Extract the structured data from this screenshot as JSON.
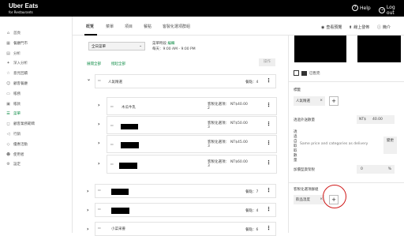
{
  "app": {
    "logo_line1": "Uber Eats",
    "logo_line2": "for Restaurants",
    "help": "Help",
    "logout": "Log out"
  },
  "sidebar": {
    "items": [
      {
        "label": "首頁",
        "icon": "home-icon"
      },
      {
        "label": "餐廳門市",
        "icon": "store-icon"
      },
      {
        "label": "分析",
        "icon": "chart-icon"
      },
      {
        "label": "深入分析",
        "icon": "sparkle-icon"
      },
      {
        "label": "意見回饋",
        "icon": "star-icon"
      },
      {
        "label": "顧客餐廳",
        "icon": "people-icon"
      },
      {
        "label": "帳務",
        "icon": "receipt-icon"
      },
      {
        "label": "帳款",
        "icon": "wallet-icon"
      },
      {
        "label": "菜單",
        "icon": "menu-icon"
      },
      {
        "label": "顧客業務範疇",
        "icon": "box-icon"
      },
      {
        "label": "行銷",
        "icon": "megaphone-icon"
      },
      {
        "label": "優惠活動",
        "icon": "tag-icon"
      },
      {
        "label": "使用者",
        "icon": "user-icon"
      },
      {
        "label": "設定",
        "icon": "gear-icon"
      }
    ],
    "active": "菜單"
  },
  "tabs": [
    "概覽",
    "菜單",
    "項目",
    "餐點",
    "客製化選項群組"
  ],
  "toolbar": {
    "preview": "查看預覽",
    "publish": "線上發佈",
    "help": "簡介"
  },
  "menu_select": {
    "value": "全日菜單",
    "hours_label": "菜單時段",
    "edit": "編輯",
    "hours": "每天：9:00 AM - 9:00 PM"
  },
  "links": {
    "expand_all": "展開全部",
    "collapse_all": "摺起全部",
    "action": "操作"
  },
  "categories": [
    {
      "name": "人氣精選",
      "count": "餐點：4",
      "open": true
    },
    {
      "name": "",
      "count": "餐點：7",
      "open": false
    },
    {
      "name": "",
      "count": "餐點：4",
      "open": false
    },
    {
      "name": "小菜采薈",
      "count": "餐點：6",
      "open": false
    }
  ],
  "items": [
    {
      "name": "木瓜牛乳",
      "opts": "客製化選項：2",
      "price": "NT$40.00"
    },
    {
      "name": "",
      "opts": "客製化選項：3",
      "price": "NT$50.00"
    },
    {
      "name": "",
      "opts": "客製化選項：3",
      "price": "NT$45.00"
    },
    {
      "name": "",
      "opts": "客製化選項：3",
      "price": "NT$60.00"
    }
  ],
  "right": {
    "sold_out": "已售完",
    "tags_label": "標籤",
    "tag": "人氣精選",
    "delivery_price_label": "透過外送數量",
    "currency": "NT$",
    "price": "40.00",
    "tax_label": "透過自取取數量",
    "tax_text": "Same price and categories as delivery",
    "change": "變更",
    "rate_label": "加價型貨架稅",
    "rate": "0",
    "pct": "%",
    "custom_label": "客製化選項群組",
    "custom_chip": "飲品溫度",
    "plus": "+"
  }
}
